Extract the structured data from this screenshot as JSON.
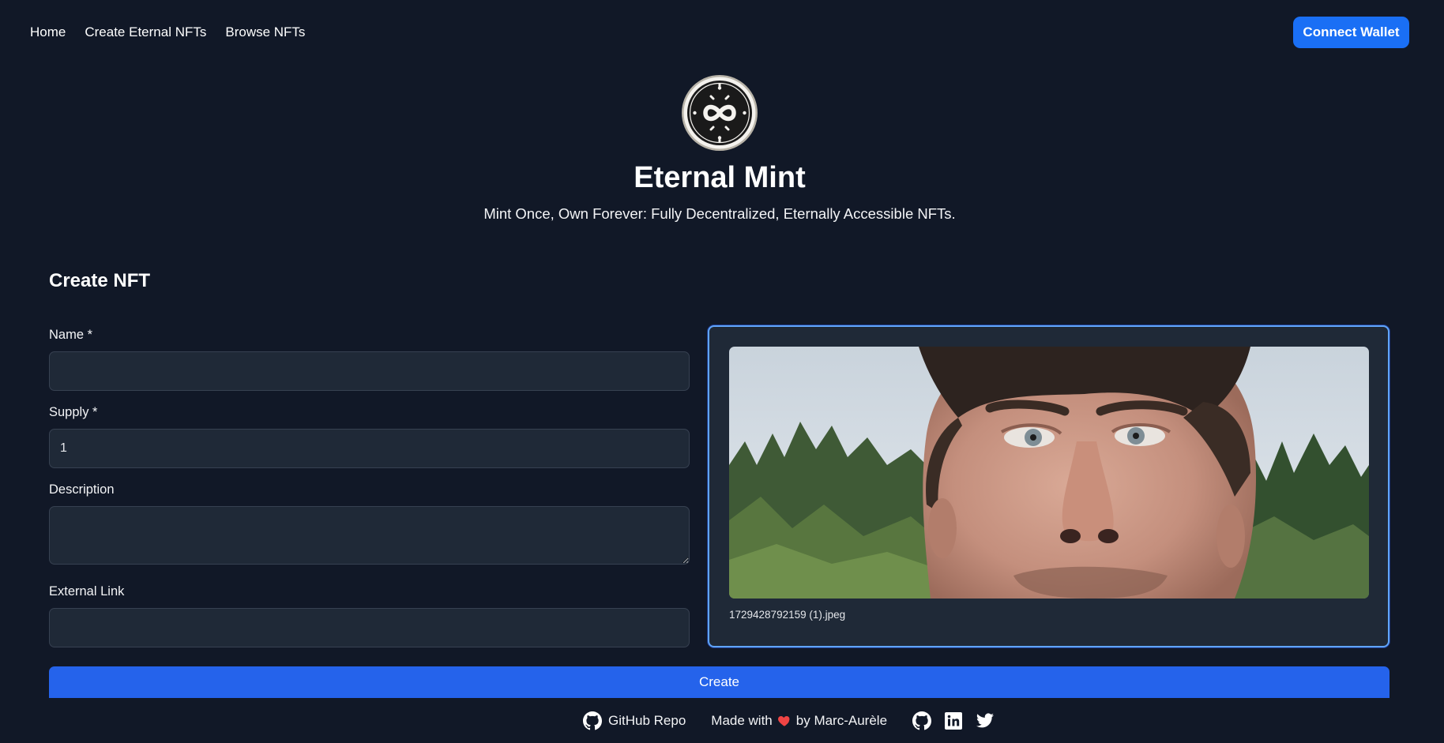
{
  "nav": {
    "links": [
      "Home",
      "Create Eternal NFTs",
      "Browse NFTs"
    ],
    "connect_label": "Connect Wallet"
  },
  "brand": {
    "logo_icon": "infinity-coin-icon",
    "title": "Eternal Mint",
    "tagline": "Mint Once, Own Forever: Fully Decentralized, Eternally Accessible NFTs."
  },
  "form": {
    "title": "Create NFT",
    "name_label": "Name *",
    "name_value": "",
    "supply_label": "Supply *",
    "supply_value": "1",
    "description_label": "Description",
    "description_value": "",
    "external_link_label": "External Link",
    "external_link_value": "",
    "create_label": "Create"
  },
  "preview": {
    "filename": "1729428792159 (1).jpeg",
    "image_icon": "uploaded-photo-preview"
  },
  "footer": {
    "repo_label": "GitHub Repo",
    "made_with_prefix": "Made with",
    "made_with_suffix": "by Marc-Aurèle",
    "heart_icon": "heart-icon",
    "social_icons": [
      "github-icon",
      "linkedin-icon",
      "twitter-icon"
    ]
  },
  "colors": {
    "background": "#111827",
    "accent": "#1a6ff5",
    "create_button": "#2563eb",
    "card_border": "#60a5fa",
    "input_bg": "#1f2937",
    "heart": "#ef4444"
  }
}
